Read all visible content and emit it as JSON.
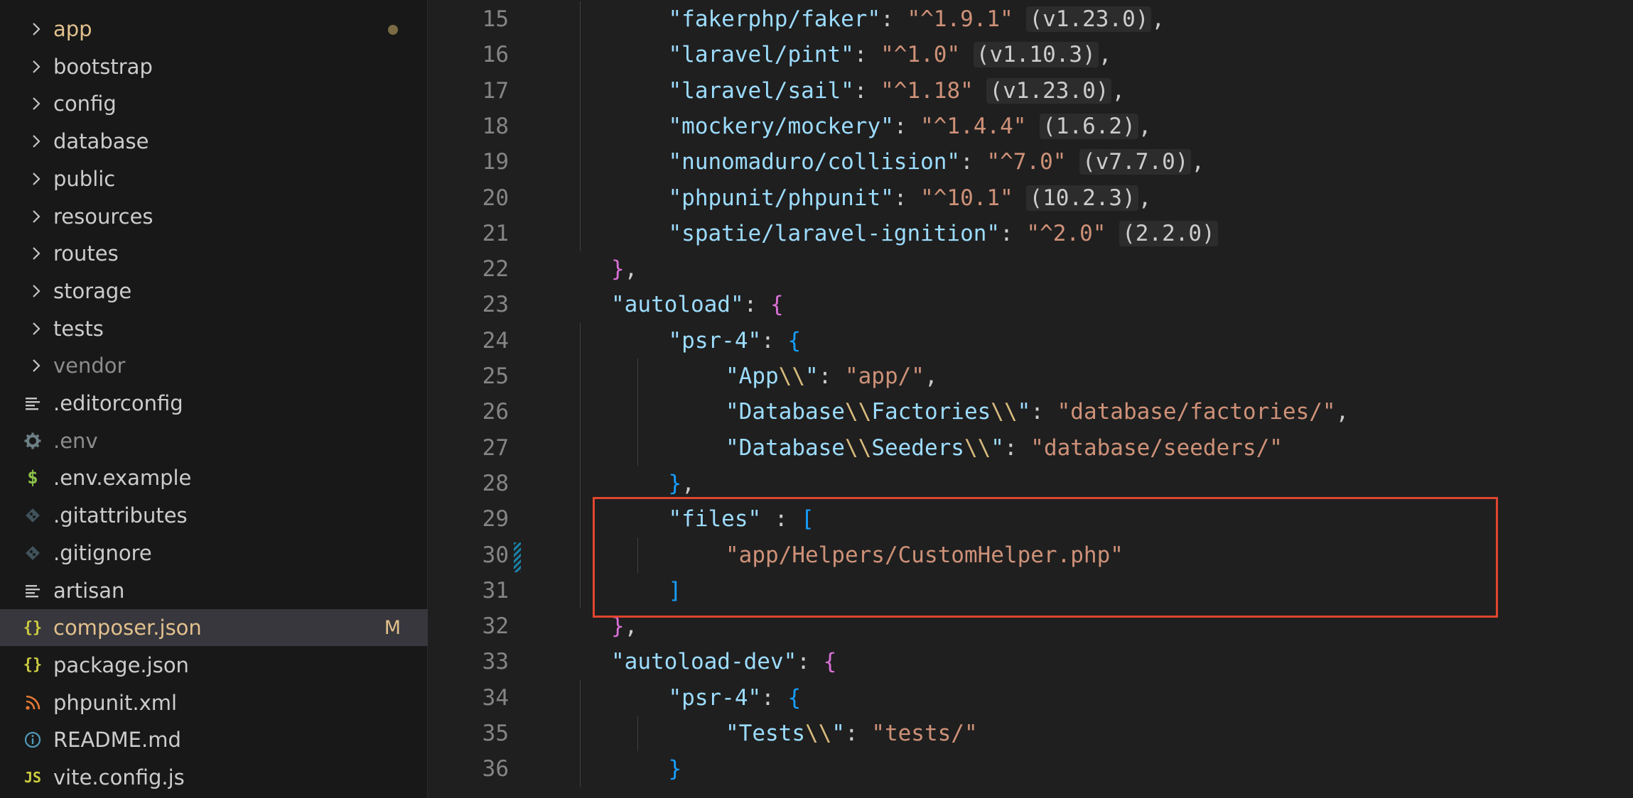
{
  "sidebar": {
    "items": [
      {
        "label": "app",
        "type": "folder",
        "color": "#e2c08d",
        "status": "dot"
      },
      {
        "label": "bootstrap",
        "type": "folder",
        "color": "#cccccc"
      },
      {
        "label": "config",
        "type": "folder",
        "color": "#cccccc"
      },
      {
        "label": "database",
        "type": "folder",
        "color": "#cccccc"
      },
      {
        "label": "public",
        "type": "folder",
        "color": "#cccccc"
      },
      {
        "label": "resources",
        "type": "folder",
        "color": "#cccccc"
      },
      {
        "label": "routes",
        "type": "folder",
        "color": "#cccccc"
      },
      {
        "label": "storage",
        "type": "folder",
        "color": "#cccccc"
      },
      {
        "label": "tests",
        "type": "folder",
        "color": "#cccccc"
      },
      {
        "label": "vendor",
        "type": "folder",
        "color": "#8c8c8c"
      },
      {
        "label": ".editorconfig",
        "type": "file",
        "icon": "lines-icon",
        "color": "#cccccc"
      },
      {
        "label": ".env",
        "type": "file",
        "icon": "gear-icon",
        "color": "#8c8c8c"
      },
      {
        "label": ".env.example",
        "type": "file",
        "icon": "dollar-icon",
        "color": "#cccccc"
      },
      {
        "label": ".gitattributes",
        "type": "file",
        "icon": "git-icon",
        "color": "#cccccc"
      },
      {
        "label": ".gitignore",
        "type": "file",
        "icon": "git-icon",
        "color": "#cccccc"
      },
      {
        "label": "artisan",
        "type": "file",
        "icon": "lines-icon",
        "color": "#cccccc"
      },
      {
        "label": "composer.json",
        "type": "file",
        "icon": "braces-icon",
        "color": "#e2c08d",
        "badge": "M",
        "selected": true
      },
      {
        "label": "package.json",
        "type": "file",
        "icon": "braces-icon",
        "color": "#cccccc"
      },
      {
        "label": "phpunit.xml",
        "type": "file",
        "icon": "rss-icon",
        "color": "#cccccc"
      },
      {
        "label": "README.md",
        "type": "file",
        "icon": "info-icon",
        "color": "#cccccc"
      },
      {
        "label": "vite.config.js",
        "type": "file",
        "icon": "js-icon",
        "color": "#cccccc"
      }
    ],
    "glyphs": {
      "braces": "{}",
      "dollar": "$",
      "js": "JS"
    }
  },
  "editor": {
    "lines": [
      {
        "n": "15",
        "indent": 2,
        "tokens": [
          [
            "key",
            "\"fakerphp/faker\""
          ],
          [
            "pun",
            ": "
          ],
          [
            "str",
            "\"^1.9.1\""
          ],
          [
            "pun",
            " "
          ],
          [
            "hint",
            "(v1.23.0)"
          ],
          [
            "pun",
            ","
          ]
        ]
      },
      {
        "n": "16",
        "indent": 2,
        "tokens": [
          [
            "key",
            "\"laravel/pint\""
          ],
          [
            "pun",
            ": "
          ],
          [
            "str",
            "\"^1.0\""
          ],
          [
            "pun",
            " "
          ],
          [
            "hint",
            "(v1.10.3)"
          ],
          [
            "pun",
            ","
          ]
        ]
      },
      {
        "n": "17",
        "indent": 2,
        "tokens": [
          [
            "key",
            "\"laravel/sail\""
          ],
          [
            "pun",
            ": "
          ],
          [
            "str",
            "\"^1.18\""
          ],
          [
            "pun",
            " "
          ],
          [
            "hint",
            "(v1.23.0)"
          ],
          [
            "pun",
            ","
          ]
        ]
      },
      {
        "n": "18",
        "indent": 2,
        "tokens": [
          [
            "key",
            "\"mockery/mockery\""
          ],
          [
            "pun",
            ": "
          ],
          [
            "str",
            "\"^1.4.4\""
          ],
          [
            "pun",
            " "
          ],
          [
            "hint",
            "(1.6.2)"
          ],
          [
            "pun",
            ","
          ]
        ]
      },
      {
        "n": "19",
        "indent": 2,
        "tokens": [
          [
            "key",
            "\"nunomaduro/collision\""
          ],
          [
            "pun",
            ": "
          ],
          [
            "str",
            "\"^7.0\""
          ],
          [
            "pun",
            " "
          ],
          [
            "hint",
            "(v7.7.0)"
          ],
          [
            "pun",
            ","
          ]
        ]
      },
      {
        "n": "20",
        "indent": 2,
        "tokens": [
          [
            "key",
            "\"phpunit/phpunit\""
          ],
          [
            "pun",
            ": "
          ],
          [
            "str",
            "\"^10.1\""
          ],
          [
            "pun",
            " "
          ],
          [
            "hint",
            "(10.2.3)"
          ],
          [
            "pun",
            ","
          ]
        ]
      },
      {
        "n": "21",
        "indent": 2,
        "tokens": [
          [
            "key",
            "\"spatie/laravel-ignition\""
          ],
          [
            "pun",
            ": "
          ],
          [
            "str",
            "\"^2.0\""
          ],
          [
            "pun",
            " "
          ],
          [
            "hint",
            "(2.2.0)"
          ]
        ]
      },
      {
        "n": "22",
        "indent": 1,
        "tokens": [
          [
            "br1",
            "}"
          ],
          [
            "pun",
            ","
          ]
        ]
      },
      {
        "n": "23",
        "indent": 1,
        "tokens": [
          [
            "key",
            "\"autoload\""
          ],
          [
            "pun",
            ": "
          ],
          [
            "br1",
            "{"
          ]
        ]
      },
      {
        "n": "24",
        "indent": 2,
        "tokens": [
          [
            "key",
            "\"psr-4\""
          ],
          [
            "pun",
            ": "
          ],
          [
            "br2",
            "{"
          ]
        ]
      },
      {
        "n": "25",
        "indent": 3,
        "tokens": [
          [
            "key",
            "\"App"
          ],
          [
            "esc",
            "\\\\"
          ],
          [
            "key",
            "\""
          ],
          [
            "pun",
            ": "
          ],
          [
            "str",
            "\"app/\""
          ],
          [
            "pun",
            ","
          ]
        ]
      },
      {
        "n": "26",
        "indent": 3,
        "tokens": [
          [
            "key",
            "\"Database"
          ],
          [
            "esc",
            "\\\\"
          ],
          [
            "key",
            "Factories"
          ],
          [
            "esc",
            "\\\\"
          ],
          [
            "key",
            "\""
          ],
          [
            "pun",
            ": "
          ],
          [
            "str",
            "\"database/factories/\""
          ],
          [
            "pun",
            ","
          ]
        ]
      },
      {
        "n": "27",
        "indent": 3,
        "tokens": [
          [
            "key",
            "\"Database"
          ],
          [
            "esc",
            "\\\\"
          ],
          [
            "key",
            "Seeders"
          ],
          [
            "esc",
            "\\\\"
          ],
          [
            "key",
            "\""
          ],
          [
            "pun",
            ": "
          ],
          [
            "str",
            "\"database/seeders/\""
          ]
        ]
      },
      {
        "n": "28",
        "indent": 2,
        "tokens": [
          [
            "br2",
            "}"
          ],
          [
            "pun",
            ","
          ]
        ]
      },
      {
        "n": "29",
        "indent": 2,
        "tokens": [
          [
            "key",
            "\"files\""
          ],
          [
            "pun",
            " : "
          ],
          [
            "br2",
            "["
          ]
        ]
      },
      {
        "n": "30",
        "indent": 3,
        "tokens": [
          [
            "str",
            "\"app/Helpers/CustomHelper.php\""
          ]
        ]
      },
      {
        "n": "31",
        "indent": 2,
        "tokens": [
          [
            "br2",
            "]"
          ]
        ]
      },
      {
        "n": "32",
        "indent": 1,
        "tokens": [
          [
            "br1",
            "}"
          ],
          [
            "pun",
            ","
          ]
        ]
      },
      {
        "n": "33",
        "indent": 1,
        "tokens": [
          [
            "key",
            "\"autoload-dev\""
          ],
          [
            "pun",
            ": "
          ],
          [
            "br1",
            "{"
          ]
        ]
      },
      {
        "n": "34",
        "indent": 2,
        "tokens": [
          [
            "key",
            "\"psr-4\""
          ],
          [
            "pun",
            ": "
          ],
          [
            "br2",
            "{"
          ]
        ]
      },
      {
        "n": "35",
        "indent": 3,
        "tokens": [
          [
            "key",
            "\"Tests"
          ],
          [
            "esc",
            "\\\\"
          ],
          [
            "key",
            "\""
          ],
          [
            "pun",
            ": "
          ],
          [
            "str",
            "\"tests/\""
          ]
        ]
      },
      {
        "n": "36",
        "indent": 2,
        "tokens": [
          [
            "br2",
            "}"
          ]
        ]
      }
    ],
    "highlight_color": "#e0452f"
  }
}
